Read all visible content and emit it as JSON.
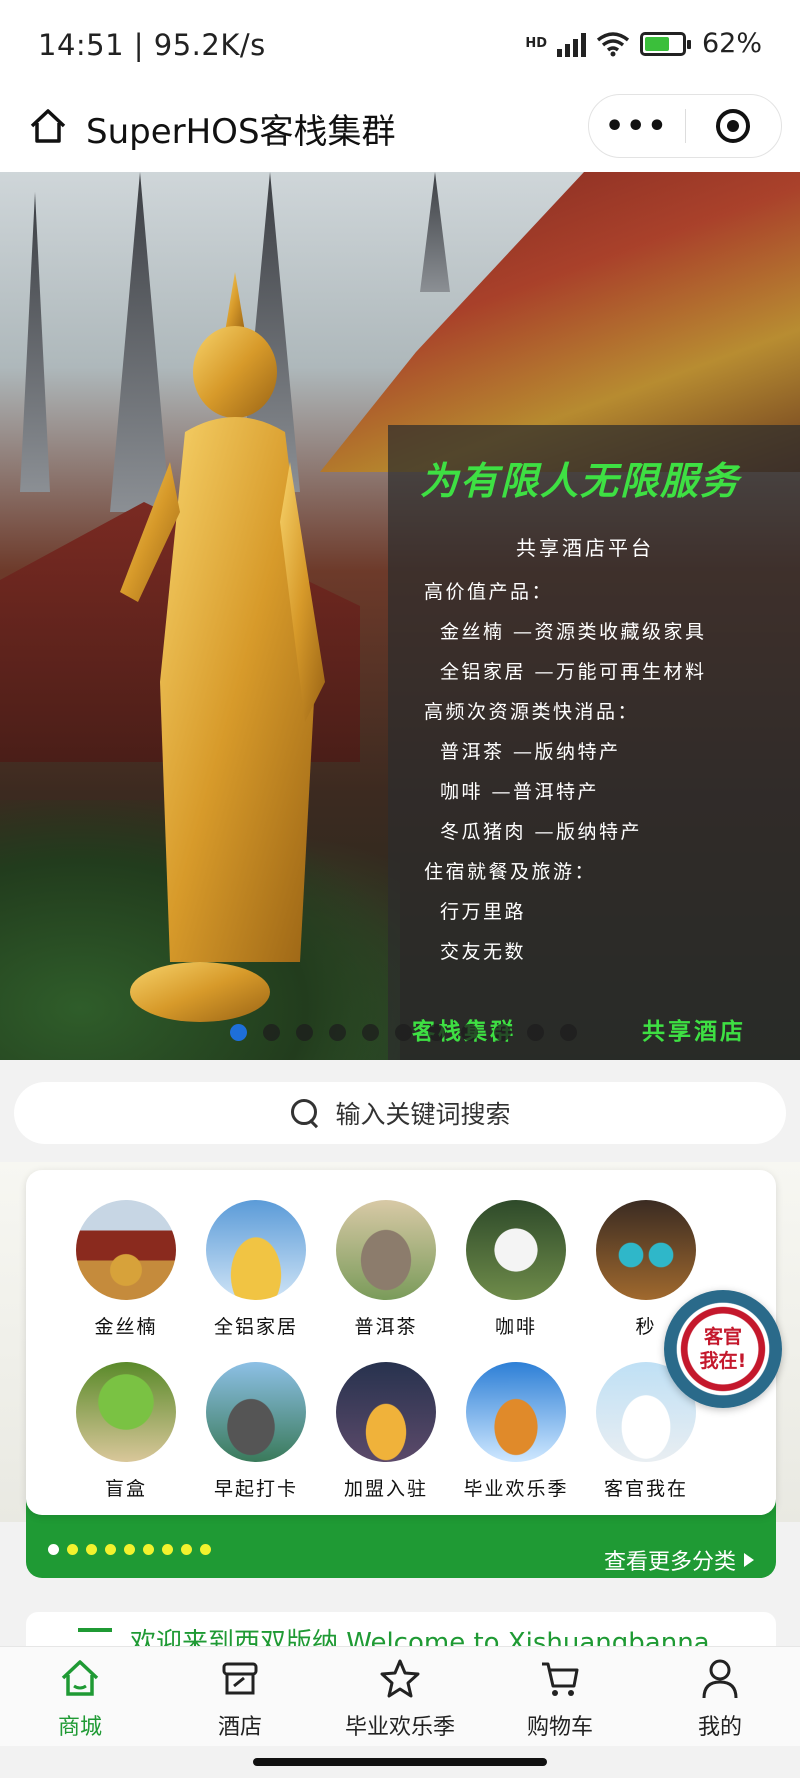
{
  "status_bar": {
    "time": "14:51 | 95.2K/s",
    "network": "HD",
    "battery": "62%"
  },
  "header": {
    "title": "SuperHOS客栈集群",
    "more_label": "•••"
  },
  "banner": {
    "slogan": "为有限人无限服务",
    "subtitle": "共享酒店平台",
    "lines": [
      {
        "text": "高价值产品：",
        "indent": false
      },
      {
        "text": "金丝楠 —资源类收藏级家具",
        "indent": true
      },
      {
        "text": "全铝家居 —万能可再生材料",
        "indent": true
      },
      {
        "text": "高频次资源类快消品：",
        "indent": false
      },
      {
        "text": "普洱茶 —版纳特产",
        "indent": true
      },
      {
        "text": "咖啡 —普洱特产",
        "indent": true
      },
      {
        "text": "冬瓜猪肉 —版纳特产",
        "indent": true
      },
      {
        "text": "住宿就餐及旅游：",
        "indent": false
      },
      {
        "text": "行万里路",
        "indent": true
      },
      {
        "text": "交友无数",
        "indent": true
      }
    ],
    "footer_left": "客栈集群",
    "footer_right": "共享酒店",
    "slide_count": 11,
    "active_slide": 0
  },
  "search": {
    "placeholder": "输入关键词搜索"
  },
  "categories": {
    "items": [
      {
        "label": "金丝楠",
        "icon": "temple-photo"
      },
      {
        "label": "全铝家居",
        "icon": "golden-pagoda-photo"
      },
      {
        "label": "普洱茶",
        "icon": "elephants-photo"
      },
      {
        "label": "咖啡",
        "icon": "white-peacock-photo"
      },
      {
        "label": "秒",
        "icon": "earrings-photo"
      },
      {
        "label": "盲盒",
        "icon": "peacock-photo"
      },
      {
        "label": "早起打卡",
        "icon": "elephant-ride-photo"
      },
      {
        "label": "加盟入驻",
        "icon": "night-pagoda-photo"
      },
      {
        "label": "毕业欢乐季",
        "icon": "temple-sky-photo"
      },
      {
        "label": "客官我在",
        "icon": "white-temple-photo"
      }
    ],
    "more_label": "查看更多分类",
    "page_dots": 9
  },
  "kefu": {
    "label": "客官我在!"
  },
  "welcome": {
    "text": "欢迎来到西双版纳 Welcome to Xishuangbanna"
  },
  "tabbar": {
    "tabs": [
      {
        "label": "商城",
        "icon": "shop-home-icon",
        "active": true
      },
      {
        "label": "酒店",
        "icon": "hotel-store-icon",
        "active": false
      },
      {
        "label": "毕业欢乐季",
        "icon": "star-icon",
        "active": false
      },
      {
        "label": "购物车",
        "icon": "cart-icon",
        "active": false
      },
      {
        "label": "我的",
        "icon": "user-icon",
        "active": false
      }
    ]
  },
  "colors": {
    "accent_green": "#1f9a34",
    "slogan_green": "#3ee043",
    "active_dot": "#1e6fd9"
  }
}
